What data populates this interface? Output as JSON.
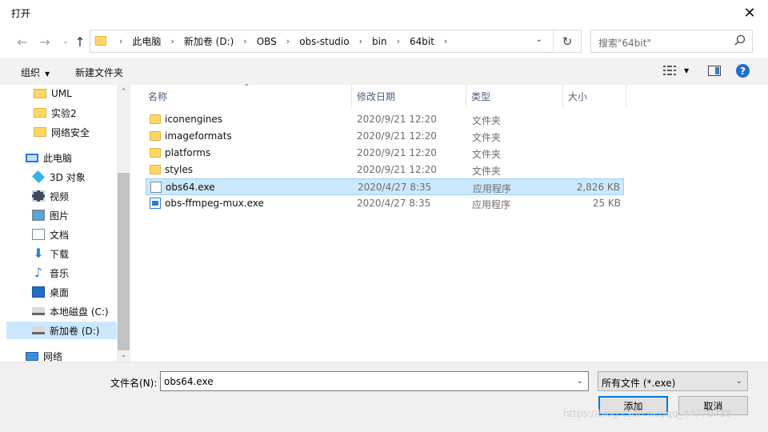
{
  "window": {
    "title": "打开"
  },
  "nav": {
    "breadcrumbs": [
      "此电脑",
      "新加卷 (D:)",
      "OBS",
      "obs-studio",
      "bin",
      "64bit"
    ],
    "search_placeholder": "搜索\"64bit\""
  },
  "toolbar": {
    "organize": "组织",
    "new_folder": "新建文件夹",
    "help": "?"
  },
  "sidebar": {
    "items": [
      {
        "label": "UML",
        "icon": "folder-icon"
      },
      {
        "label": "实验2",
        "icon": "folder-icon"
      },
      {
        "label": "网络安全",
        "icon": "folder-icon"
      },
      {
        "label": "此电脑",
        "icon": "this-pc-icon"
      },
      {
        "label": "3D 对象",
        "icon": "3d-objects-icon"
      },
      {
        "label": "视频",
        "icon": "video-icon"
      },
      {
        "label": "图片",
        "icon": "pictures-icon"
      },
      {
        "label": "文档",
        "icon": "documents-icon"
      },
      {
        "label": "下载",
        "icon": "downloads-icon"
      },
      {
        "label": "音乐",
        "icon": "music-icon"
      },
      {
        "label": "桌面",
        "icon": "desktop-icon"
      },
      {
        "label": "本地磁盘 (C:)",
        "icon": "drive-icon"
      },
      {
        "label": "新加卷 (D:)",
        "icon": "drive-icon",
        "selected": true
      },
      {
        "label": "网络",
        "icon": "network-icon"
      }
    ]
  },
  "files": {
    "headers": {
      "name": "名称",
      "date": "修改日期",
      "type": "类型",
      "size": "大小"
    },
    "rows": [
      {
        "name": "iconengines",
        "date": "2020/9/21 12:20",
        "type": "文件夹",
        "size": "",
        "icon": "folder-icon"
      },
      {
        "name": "imageformats",
        "date": "2020/9/21 12:20",
        "type": "文件夹",
        "size": "",
        "icon": "folder-icon"
      },
      {
        "name": "platforms",
        "date": "2020/9/21 12:20",
        "type": "文件夹",
        "size": "",
        "icon": "folder-icon"
      },
      {
        "name": "styles",
        "date": "2020/9/21 12:20",
        "type": "文件夹",
        "size": "",
        "icon": "folder-icon"
      },
      {
        "name": "obs64.exe",
        "date": "2020/4/27 8:35",
        "type": "应用程序",
        "size": "2,826 KB",
        "icon": "exe-icon",
        "selected": true
      },
      {
        "name": "obs-ffmpeg-mux.exe",
        "date": "2020/4/27 8:35",
        "type": "应用程序",
        "size": "25 KB",
        "icon": "app-icon"
      }
    ]
  },
  "footer": {
    "filename_label": "文件名(N):",
    "filename_value": "obs64.exe",
    "filter_value": "所有文件 (*.exe)",
    "add_button": "添加",
    "cancel_button": "取消"
  },
  "watermark": "https://blog.csdn.net/qq_44770738"
}
